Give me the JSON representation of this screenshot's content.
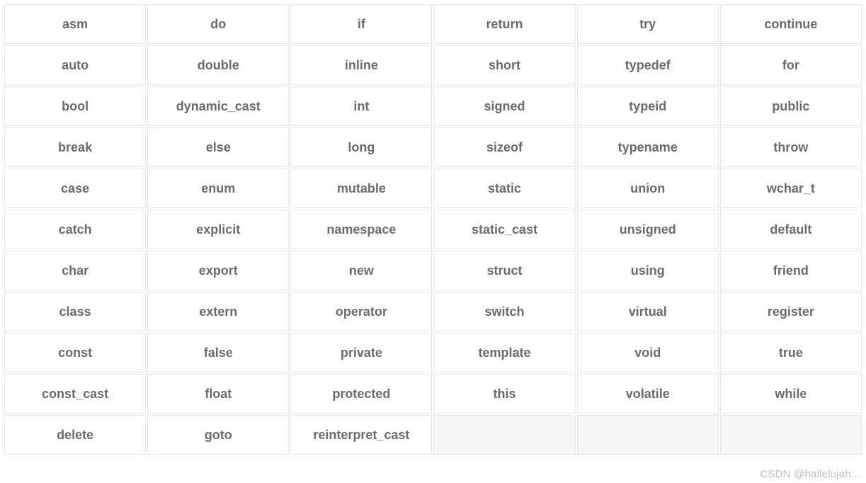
{
  "columns": 6,
  "rows": [
    [
      "asm",
      "do",
      "if",
      "return",
      "try",
      "continue"
    ],
    [
      "auto",
      "double",
      "inline",
      "short",
      "typedef",
      "for"
    ],
    [
      "bool",
      "dynamic_cast",
      "int",
      "signed",
      "typeid",
      "public"
    ],
    [
      "break",
      "else",
      "long",
      "sizeof",
      "typename",
      "throw"
    ],
    [
      "case",
      "enum",
      "mutable",
      "static",
      "union",
      "wchar_t"
    ],
    [
      "catch",
      "explicit",
      "namespace",
      "static_cast",
      "unsigned",
      "default"
    ],
    [
      "char",
      "export",
      "new",
      "struct",
      "using",
      "friend"
    ],
    [
      "class",
      "extern",
      "operator",
      "switch",
      "virtual",
      "register"
    ],
    [
      "const",
      "false",
      "private",
      "template",
      "void",
      "true"
    ],
    [
      "const_cast",
      "float",
      "protected",
      "this",
      "volatile",
      "while"
    ],
    [
      "delete",
      "goto",
      "reinterpret_cast",
      "",
      "",
      ""
    ]
  ],
  "watermark": "CSDN @hallelujah..."
}
